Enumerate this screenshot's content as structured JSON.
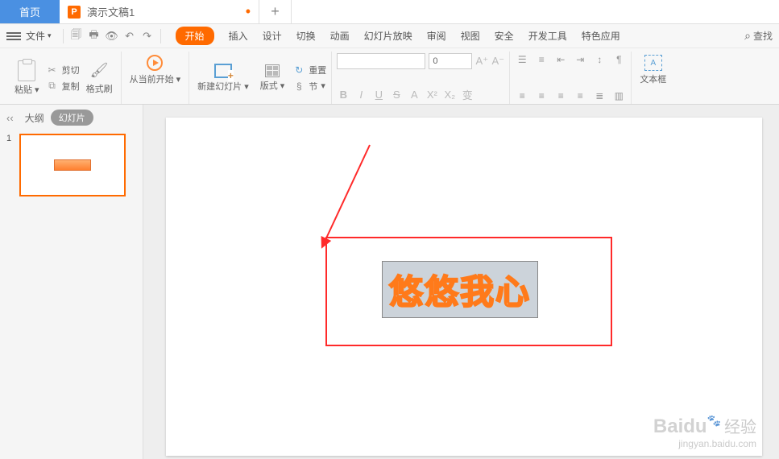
{
  "tabs": {
    "home": "首页",
    "doc": "演示文稿1",
    "doc_icon": "P",
    "modified": "•",
    "add": "+"
  },
  "menu": {
    "file": "文件",
    "items": [
      "开始",
      "插入",
      "设计",
      "切换",
      "动画",
      "幻灯片放映",
      "审阅",
      "视图",
      "安全",
      "开发工具",
      "特色应用"
    ],
    "active_index": 0,
    "search_icon": "⌕",
    "search": "查找"
  },
  "ribbon": {
    "paste": "粘贴",
    "cut": "剪切",
    "copy": "复制",
    "format_brush": "格式刷",
    "play": "从当前开始",
    "new_slide": "新建幻灯片",
    "layout": "版式",
    "reset": "重置",
    "section": "节",
    "font_size": "0",
    "textbox": "文本框",
    "text_buttons": [
      "B",
      "I",
      "U",
      "S",
      "A",
      "X²",
      "X₂",
      "变"
    ],
    "inc_font": "A⁺",
    "dec_font": "A⁻"
  },
  "sidebar": {
    "collapse": "‹‹",
    "outline": "大纲",
    "slides": "幻灯片",
    "thumbs": [
      {
        "num": "1"
      }
    ]
  },
  "slide": {
    "text": "悠悠我心"
  },
  "watermark": {
    "brand": "Baidu",
    "cn": "经验",
    "url": "jingyan.baidu.com"
  }
}
